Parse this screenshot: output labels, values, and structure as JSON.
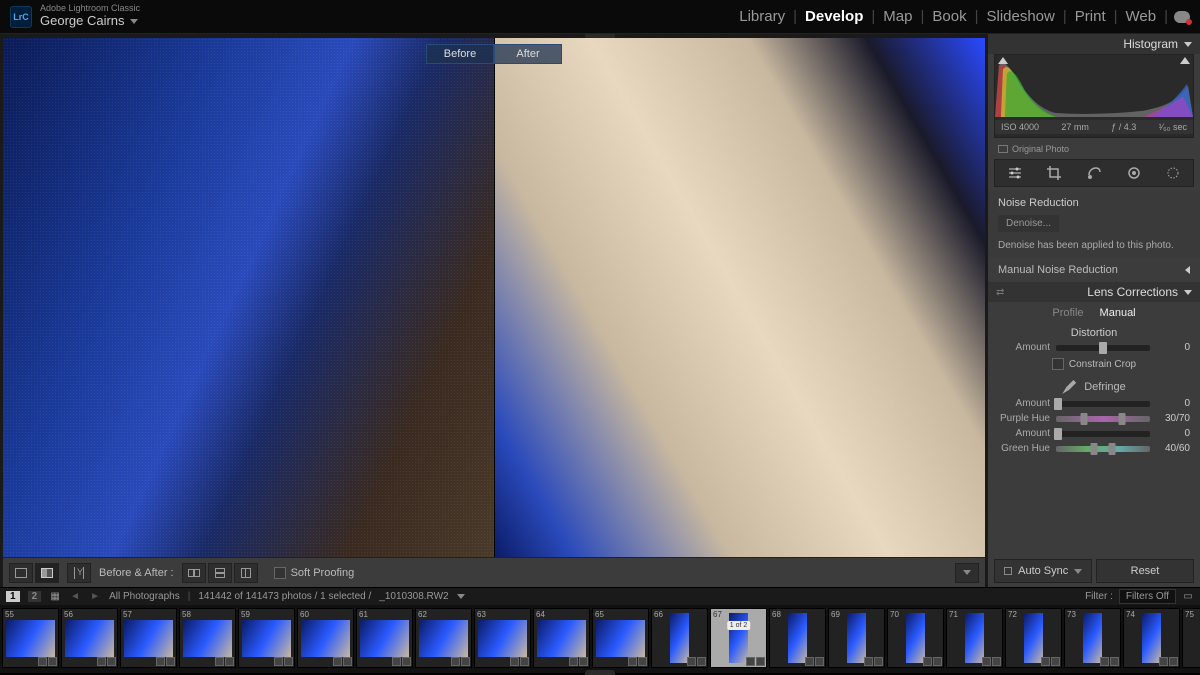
{
  "header": {
    "app_name": "Adobe Lightroom Classic",
    "logo_text": "LrC",
    "user": "George Cairns",
    "modules": [
      "Library",
      "Develop",
      "Map",
      "Book",
      "Slideshow",
      "Print",
      "Web"
    ],
    "active_module": "Develop"
  },
  "preview": {
    "before_label": "Before",
    "after_label": "After"
  },
  "toolbar": {
    "mode_label": "Before & After :",
    "soft_proofing": "Soft Proofing"
  },
  "panel": {
    "histogram_title": "Histogram",
    "metadata": {
      "iso": "ISO 4000",
      "focal": "27 mm",
      "aperture": "ƒ / 4.3",
      "shutter": "¹⁄₆₀ sec"
    },
    "original_photo": "Original Photo",
    "noise": {
      "title": "Noise Reduction",
      "denoise_btn": "Denoise...",
      "applied_msg": "Denoise has been applied to this photo."
    },
    "mnr_title": "Manual Noise Reduction",
    "lens": {
      "title": "Lens Corrections",
      "tab_profile": "Profile",
      "tab_manual": "Manual",
      "distortion_title": "Distortion",
      "amount_label": "Amount",
      "distortion_amount": "0",
      "constrain": "Constrain Crop",
      "defringe_title": "Defringe",
      "defringe_amount1": "0",
      "purple_hue_label": "Purple Hue",
      "purple_hue": "30/70",
      "defringe_amount2": "0",
      "green_hue_label": "Green Hue",
      "green_hue": "40/60"
    },
    "auto_sync": "Auto Sync",
    "reset": "Reset"
  },
  "filmstrip_header": {
    "monitors": [
      "1",
      "2"
    ],
    "collection": "All Photographs",
    "count": "141442 of 141473 photos / 1 selected /",
    "filename": "_1010308.RW2",
    "filter_label": "Filter :",
    "filter_value": "Filters Off"
  },
  "filmstrip": {
    "start_index": 55,
    "count": 21,
    "selected_index": 67,
    "vertical_from": 66,
    "processing_label": "1 of 2"
  }
}
